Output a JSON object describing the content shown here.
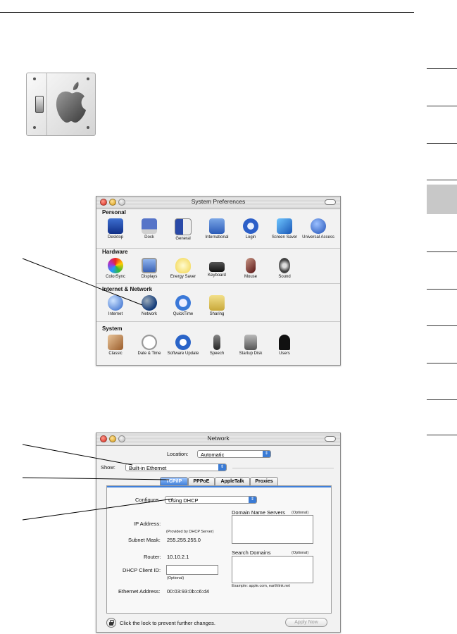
{
  "system_preferences": {
    "title": "System Preferences",
    "sections": [
      {
        "label": "Personal",
        "items": [
          "Desktop",
          "Dock",
          "General",
          "International",
          "Login",
          "Screen Saver",
          "Universal Access"
        ]
      },
      {
        "label": "Hardware",
        "items": [
          "ColorSync",
          "Displays",
          "Energy Saver",
          "Keyboard",
          "Mouse",
          "Sound"
        ]
      },
      {
        "label": "Internet & Network",
        "items": [
          "Internet",
          "Network",
          "QuickTime",
          "Sharing"
        ]
      },
      {
        "label": "System",
        "items": [
          "Classic",
          "Date & Time",
          "Software Update",
          "Speech",
          "Startup Disk",
          "Users"
        ]
      }
    ]
  },
  "network": {
    "title": "Network",
    "location_label": "Location:",
    "location_value": "Automatic",
    "show_label": "Show:",
    "show_value": "Built-in Ethernet",
    "tabs": [
      "TCP/IP",
      "PPPoE",
      "AppleTalk",
      "Proxies"
    ],
    "configure_label": "Configure:",
    "configure_value": "Using DHCP",
    "dns_label": "Domain Name Servers",
    "dns_optional": "(Optional)",
    "ip_label": "IP Address:",
    "ip_note": "(Provided by DHCP Server)",
    "subnet_label": "Subnet Mask:",
    "subnet_value": "255.255.255.0",
    "router_label": "Router:",
    "router_value": "10.10.2.1",
    "search_label": "Search Domains",
    "search_optional": "(Optional)",
    "dhcp_label": "DHCP Client ID:",
    "dhcp_optional": "(Optional)",
    "example_text": "Example: apple.com, earthlink.net",
    "ethernet_label": "Ethernet Address:",
    "ethernet_value": "00:03:93:0b:c6:d4",
    "lock_text": "Click the lock to prevent further changes.",
    "apply_label": "Apply Now"
  },
  "colors": {
    "accent": "#3f7fd9",
    "panel": "#f2f2f2"
  }
}
